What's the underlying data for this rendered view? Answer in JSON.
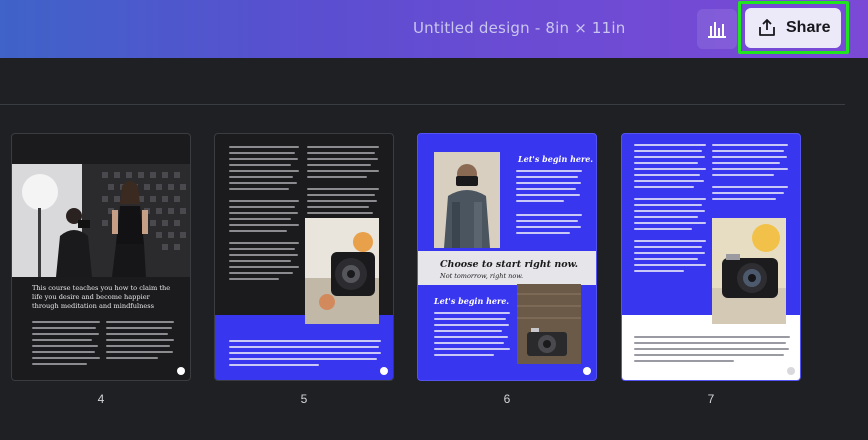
{
  "header": {
    "title": "Untitled design - 8in × 11in",
    "share_label": "Share",
    "insights_icon": "bar-chart-icon",
    "share_icon": "upload-icon",
    "highlight_color": "#21e61f"
  },
  "pages": [
    {
      "number": "4",
      "headline": "This course teaches you how to claim the life you desire and become happier through meditation and mindfulness",
      "bg": "#1b1b1d"
    },
    {
      "number": "5",
      "bg": "#1b1b1d",
      "accent": "#3936f0"
    },
    {
      "number": "6",
      "heading_top": "Let's begin here.",
      "banner_main": "Choose to start right now.",
      "banner_sub": "Not tomorrow, right now.",
      "heading_bottom": "Let's begin here.",
      "bg": "#3936f0"
    },
    {
      "number": "7",
      "bg": "#3936f0"
    }
  ]
}
